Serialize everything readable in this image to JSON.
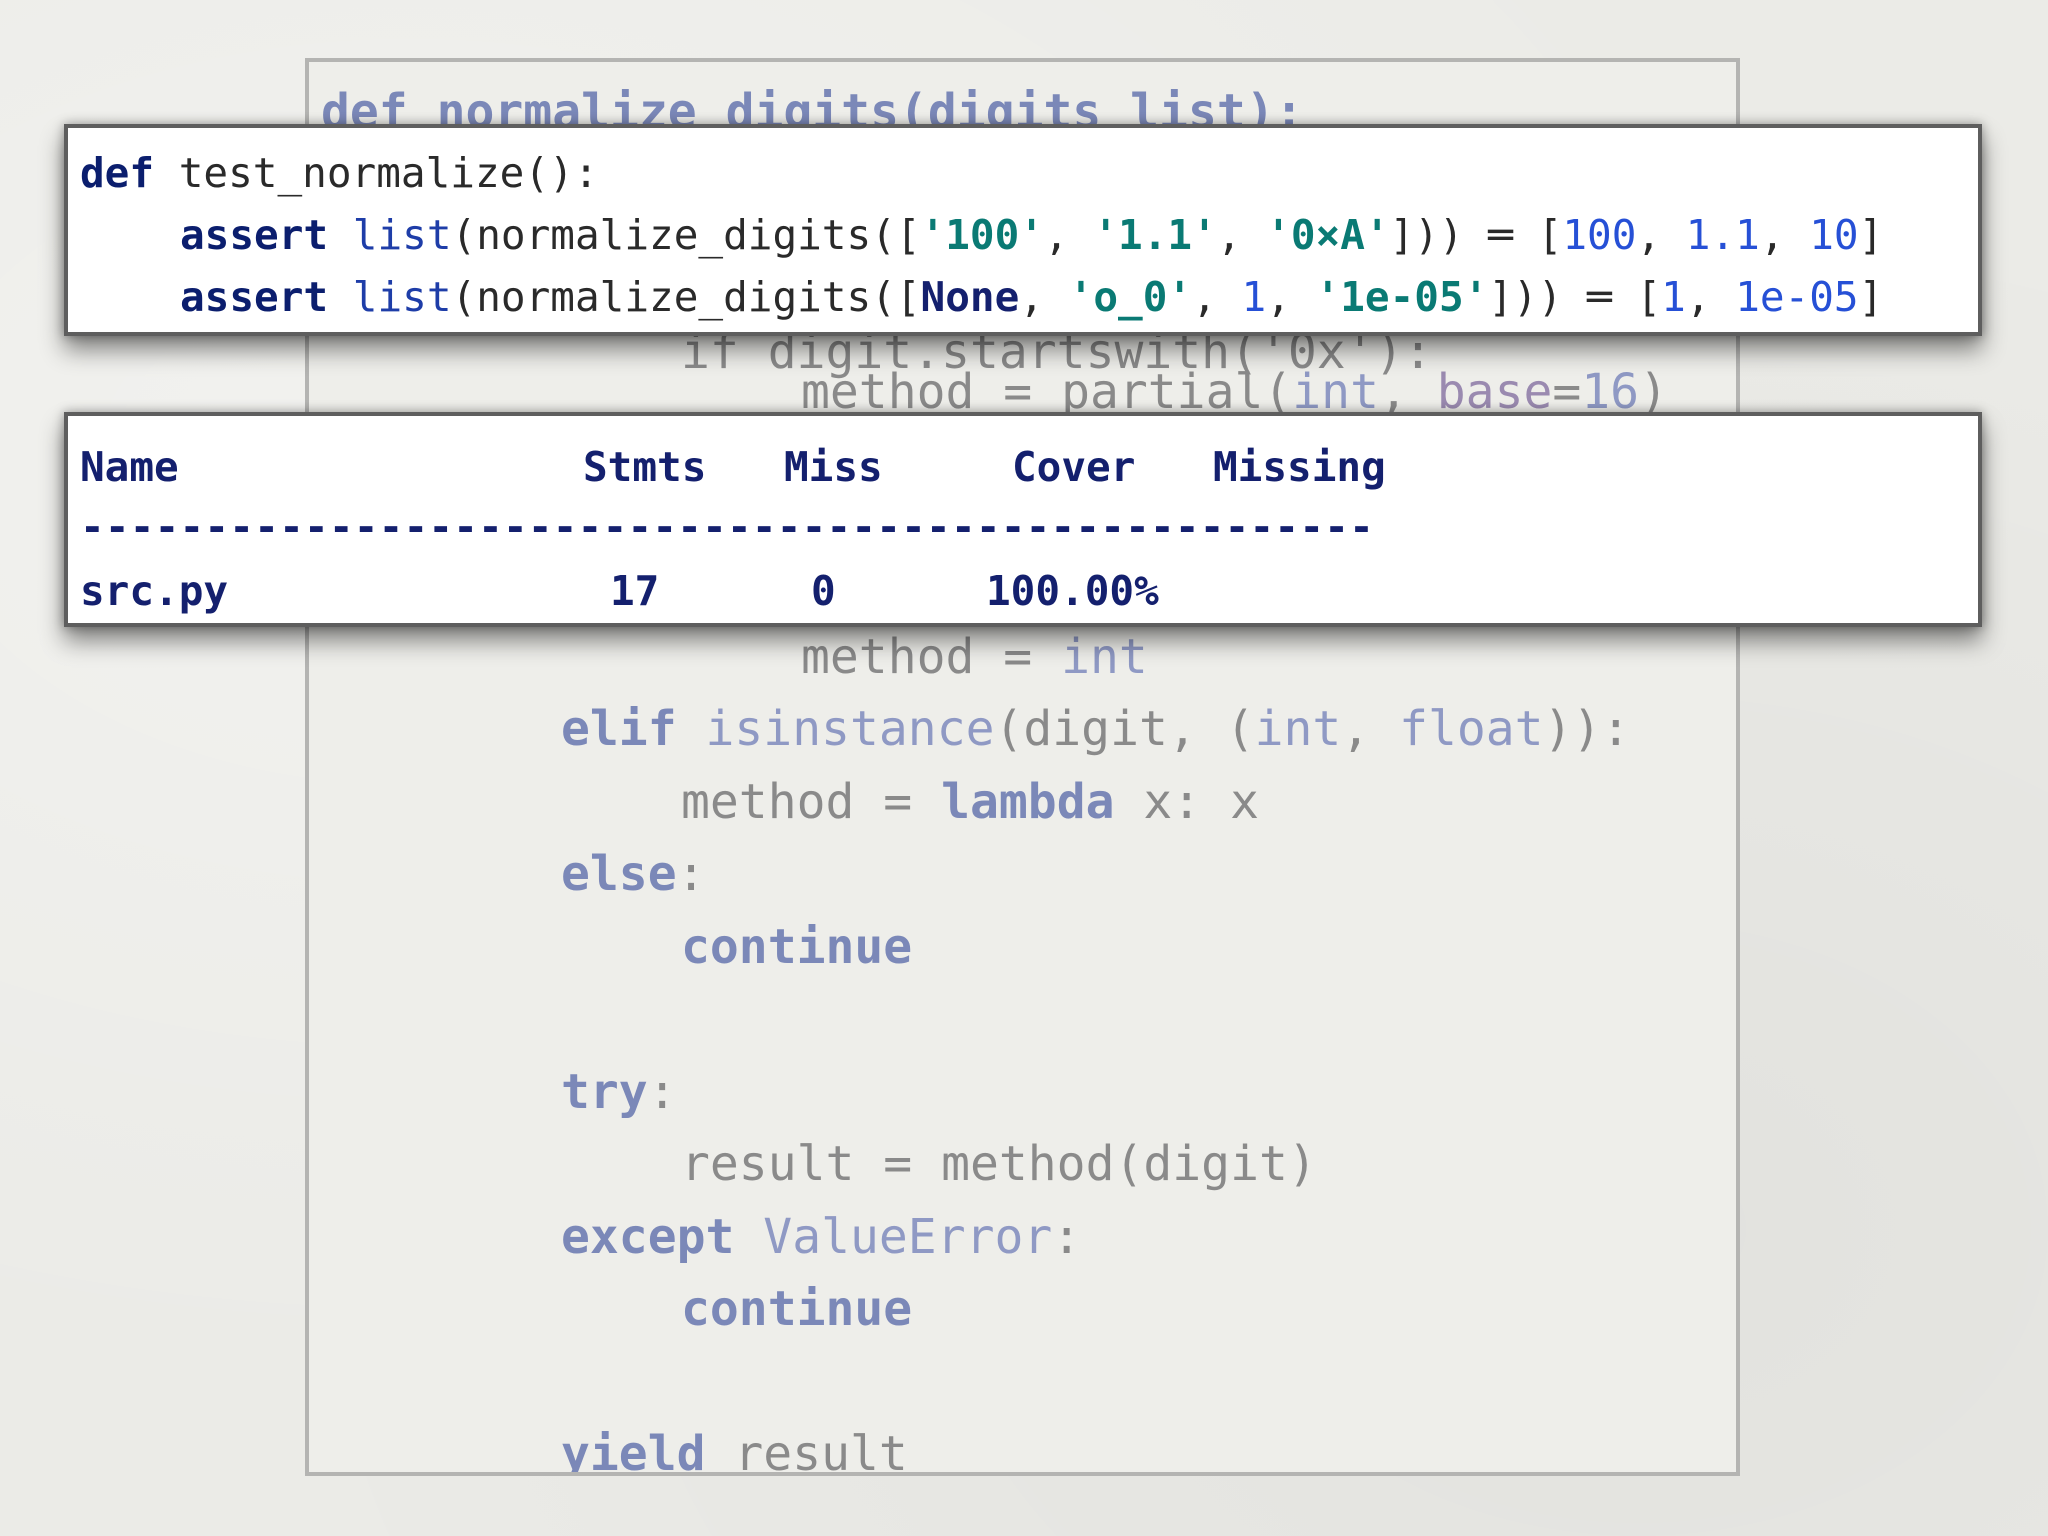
{
  "source": {
    "l1": "def normalize_digits(digits_list):",
    "l3": "if digit.startswith('0x'):",
    "l4_a": "method = partial(",
    "l4_b": "int",
    "l4_c": ", ",
    "l4_d": "base",
    "l4_e": "=",
    "l4_f": "16",
    "l4_g": ")",
    "l8_a": "method = ",
    "l8_b": "int",
    "l9_a": "elif",
    "l9_b": " ",
    "l9_c": "isinstance",
    "l9_d": "(digit, (",
    "l9_e": "int",
    "l9_f": ", ",
    "l9_g": "float",
    "l9_h": ")):",
    "l10_a": "method = ",
    "l10_b": "lambda",
    "l10_c": " x: x",
    "l11_a": "else",
    "l11_b": ":",
    "l12": "continue",
    "l14_a": "try",
    "l14_b": ":",
    "l15": "result = method(digit)",
    "l16_a": "except",
    "l16_b": " ",
    "l16_c": "ValueError",
    "l16_d": ":",
    "l17": "continue",
    "l19_a": "yield",
    "l19_b": " result"
  },
  "test": {
    "r1_kw": "def",
    "r1_rest": " test_normalize():",
    "r2_kw": "assert",
    "r2_sp": " ",
    "r2_list": "list",
    "r2_a": "(normalize_digits([",
    "r2_s1": "'100'",
    "r2_c1": ", ",
    "r2_s2": "'1.1'",
    "r2_c2": ", ",
    "r2_s3": "'0×A'",
    "r2_b": "])) ═ [",
    "r2_n1": "100",
    "r2_c3": ", ",
    "r2_n2": "1.1",
    "r2_c4": ", ",
    "r2_n3": "10",
    "r2_end": "]",
    "r3_kw": "assert",
    "r3_sp": " ",
    "r3_list": "list",
    "r3_a": "(normalize_digits([",
    "r3_none": "None",
    "r3_c1": ", ",
    "r3_s1": "'o_0'",
    "r3_c2": ", ",
    "r3_n1": "1",
    "r3_c3": ", ",
    "r3_s2": "'1e-05'",
    "r3_b": "])) ═ [",
    "r3_n2": "1",
    "r3_c4": ", ",
    "r3_n3": "1e-05",
    "r3_end": "]"
  },
  "coverage": {
    "h_name": "Name",
    "h_stmts": "Stmts",
    "h_miss": "Miss",
    "h_cover": "Cover",
    "h_missing": "Missing",
    "divider": "----------------------------------------------------",
    "file": "src.py",
    "stmts": "17",
    "miss": "0",
    "cover": "100.00%"
  },
  "colors": {
    "keyword": "#0b1e6e",
    "string": "#0a7a74",
    "number": "#2650d6",
    "builtin": "#1e3da8"
  }
}
